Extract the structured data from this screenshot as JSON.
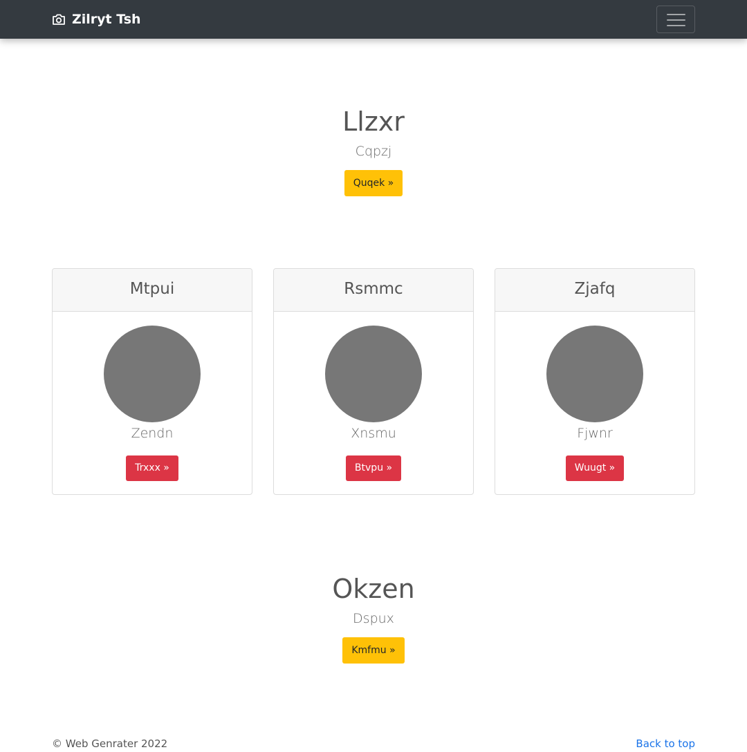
{
  "navbar": {
    "brand": "Zilryt Tsh",
    "brand_icon": "camera-icon",
    "toggler_icon": "hamburger-menu-icon"
  },
  "hero": {
    "title": "Llzxr",
    "subtitle": "Cqpzj",
    "button": "Quqek »"
  },
  "cards": [
    {
      "header": "Mtpui",
      "text": "Zendn",
      "button": "Trxxx »"
    },
    {
      "header": "Rsmmc",
      "text": "Xnsmu",
      "button": "Btvpu »"
    },
    {
      "header": "Zjafq",
      "text": "Fjwnr",
      "button": "Wuugt »"
    }
  ],
  "section2": {
    "title": "Okzen",
    "subtitle": "Dspux",
    "button": "Kmfmu »"
  },
  "footer": {
    "copyright": "© Web Genrater 2022",
    "back_to_top": "Back to top"
  },
  "colors": {
    "navbar": "#343a40",
    "warning": "#ffc107",
    "danger": "#dc3545",
    "avatar_placeholder": "#777777",
    "link": "#1a73e8"
  }
}
